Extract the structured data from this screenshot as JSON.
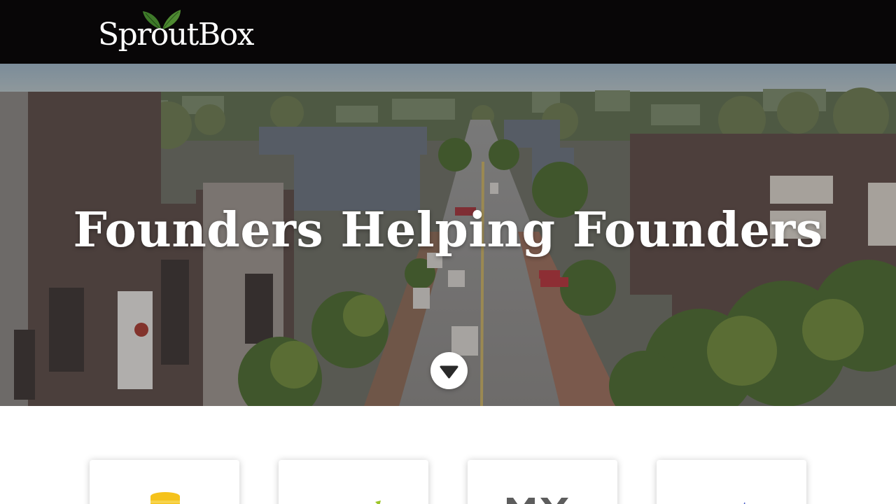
{
  "header": {
    "logo_text": "SproutBox",
    "logo_icon": "leaves-icon",
    "background": "#080607"
  },
  "hero": {
    "title": "Founders Helping Founders",
    "scroll_icon": "chevron-down-icon"
  },
  "portfolio": {
    "cards": [
      {
        "logo_icon": "yellow-stack-logo-icon"
      },
      {
        "logo_icon": "green-leaf-logo-icon"
      },
      {
        "logo_icon": "mx-logo-icon"
      },
      {
        "logo_icon": "blue-mark-logo-icon"
      }
    ]
  },
  "colors": {
    "accent_green": "#3f7a2a",
    "white": "#ffffff"
  }
}
